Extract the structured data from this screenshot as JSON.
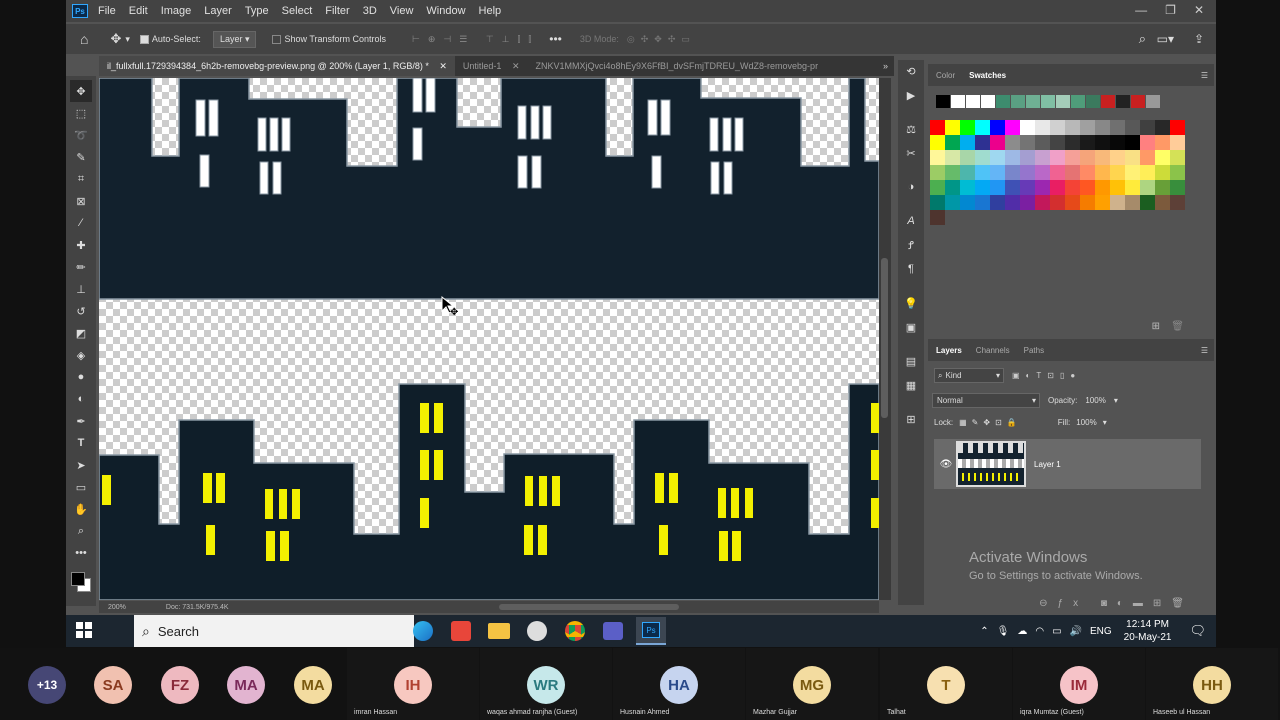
{
  "app": {
    "logo_text": "Ps"
  },
  "menu": [
    "File",
    "Edit",
    "Image",
    "Layer",
    "Type",
    "Select",
    "Filter",
    "3D",
    "View",
    "Window",
    "Help"
  ],
  "window_controls": [
    "—",
    "❐",
    "✕"
  ],
  "options_bar": {
    "auto_select_label": "Auto-Select:",
    "auto_select_value": "Layer",
    "transform_label": "Show Transform Controls",
    "mode_3d": "3D Mode:"
  },
  "tabs": [
    {
      "label": "il_fullxfull.1729394384_6h2b-removebg-preview.png @ 200% (Layer 1, RGB/8) *",
      "close": "✕"
    },
    {
      "label": "Untitled-1",
      "close": "✕"
    },
    {
      "label": "ZNKV1MMXjQvci4o8hEy9X6FfBI_dvSFmjTDREU_WdZ8-removebg-pr",
      "close": ""
    }
  ],
  "status": {
    "zoom": "200%",
    "doc": "Doc: 731.5K/975.4K"
  },
  "color_panel": {
    "tabs": [
      "Color",
      "Swatches"
    ],
    "active": "Swatches"
  },
  "recent_swatches": [
    "#000000",
    "#ffffff",
    "#ffffff",
    "#ffffff",
    "#3d8c6e",
    "#5aa083",
    "#6fb094",
    "#80bfa4",
    "#a4cdb9",
    "#4f9d7a",
    "#3b7a5e",
    "#c82020",
    "#222222",
    "#c82020",
    "#999999"
  ],
  "swatches": [
    "#ff0000",
    "#ffff00",
    "#00ff00",
    "#00ffff",
    "#0000ff",
    "#ff00ff",
    "#ffffff",
    "#e8e8e8",
    "#d0d0d0",
    "#b8b8b8",
    "#a0a0a0",
    "#888888",
    "#707070",
    "#585858",
    "#404040",
    "#282828",
    "#ff0000",
    "#ffff00",
    "#00a651",
    "#00aeef",
    "#2e3192",
    "#ec008c",
    "#8c8c8c",
    "#747474",
    "#5c5c5c",
    "#444444",
    "#2c2c2c",
    "#1a1a1a",
    "#101010",
    "#080808",
    "#000000",
    "#ff8080",
    "#ff9966",
    "#ffcc99",
    "#fff799",
    "#d7e8a6",
    "#a8d6a8",
    "#a0dccf",
    "#9fd8f0",
    "#9eb9e5",
    "#a49ed1",
    "#c8a0d0",
    "#f0a0c8",
    "#f5a098",
    "#f5a47a",
    "#f8b97a",
    "#ffd18a",
    "#f9e085",
    "#ff9966",
    "#ffff66",
    "#d4e157",
    "#9ccc65",
    "#66bb6a",
    "#4db6ac",
    "#4fc3f7",
    "#64b5f6",
    "#7986cb",
    "#9575cd",
    "#ba68c8",
    "#f06292",
    "#e57373",
    "#ff8a65",
    "#ffb74d",
    "#ffd54f",
    "#fff176",
    "#ffee58",
    "#cddc39",
    "#8bc34a",
    "#4caf50",
    "#009688",
    "#00bcd4",
    "#03a9f4",
    "#2196f3",
    "#3f51b5",
    "#673ab7",
    "#9c27b0",
    "#e91e63",
    "#f44336",
    "#ff5722",
    "#ff9800",
    "#ffc107",
    "#ffeb3b",
    "#aed581",
    "#689f38",
    "#388e3c",
    "#00796b",
    "#0097a7",
    "#0288d1",
    "#1976d2",
    "#303f9f",
    "#512da8",
    "#7b1fa2",
    "#c2185b",
    "#d32f2f",
    "#e64a19",
    "#f57c00",
    "#ffa000",
    "#cfb28c",
    "#a68b6a",
    "#1b5e20",
    "#7c5a3c",
    "#5d4037",
    "#4e342e"
  ],
  "layers_panel": {
    "tabs": [
      "Layers",
      "Channels",
      "Paths"
    ],
    "active": "Layers",
    "filter": "Kind",
    "blend_mode": "Normal",
    "opacity_label": "Opacity:",
    "opacity": "100%",
    "lock_label": "Lock:",
    "fill_label": "Fill:",
    "fill": "100%",
    "layer_name": "Layer 1"
  },
  "watermark": {
    "title": "Activate Windows",
    "subtitle": "Go to Settings to activate Windows."
  },
  "taskbar": {
    "search_placeholder": "Search",
    "language": "ENG",
    "time": "12:14 PM",
    "date": "20-May-21"
  },
  "participants": [
    {
      "initials": "+13",
      "name": "",
      "color": "#464775",
      "text": "#ffffff"
    },
    {
      "initials": "SA",
      "name": "",
      "color": "#f1c1b0",
      "text": "#8a3a20"
    },
    {
      "initials": "FZ",
      "name": "",
      "color": "#eeb9c0",
      "text": "#8a2a3a"
    },
    {
      "initials": "MA",
      "name": "",
      "color": "#e2b4d0",
      "text": "#7a2a5a"
    },
    {
      "initials": "MA",
      "name": "",
      "color": "#f3dca0",
      "text": "#7a5a10"
    },
    {
      "initials": "IH",
      "name": "imran Hassan",
      "color": "#f7c8c0",
      "text": "#b04030"
    },
    {
      "initials": "WR",
      "name": "waqas ahmad ranjha (Guest)",
      "color": "#c6e8ea",
      "text": "#2a7a80"
    },
    {
      "initials": "HA",
      "name": "Husnain Ahmed",
      "color": "#c6d4ef",
      "text": "#2a4a8a"
    },
    {
      "initials": "MG",
      "name": "Mazhar Gujjar",
      "color": "#f3dca0",
      "text": "#7a5a10"
    },
    {
      "initials": "T",
      "name": "Talhat",
      "color": "#f7e0b0",
      "text": "#8a6010"
    },
    {
      "initials": "IM",
      "name": "iqra Mumtaz (Guest)",
      "color": "#f6c3c8",
      "text": "#9a2a3a"
    },
    {
      "initials": "HH",
      "name": "Haseeb ul Hassan",
      "color": "#f3dca0",
      "text": "#7a5a10"
    }
  ]
}
